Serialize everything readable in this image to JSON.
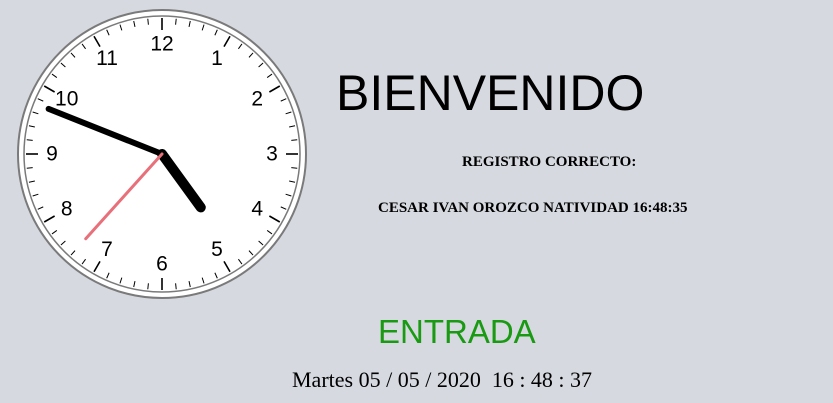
{
  "clock": {
    "numerals": [
      "12",
      "1",
      "2",
      "3",
      "4",
      "5",
      "6",
      "7",
      "8",
      "9",
      "10",
      "11"
    ],
    "hours": 16,
    "minutes": 48,
    "seconds": 37,
    "hand_color": "#000000",
    "second_hand_color": "#e8707a"
  },
  "header": {
    "title": "BIENVENIDO"
  },
  "registro": {
    "label": "REGISTRO CORRECTO:",
    "user_line": "CESAR IVAN OROZCO NATIVIDAD 16:48:35"
  },
  "status": {
    "label": "ENTRADA",
    "color": "#1a9a12"
  },
  "datetime": {
    "text": "Martes 05 / 05 / 2020  16 : 48 : 37"
  }
}
